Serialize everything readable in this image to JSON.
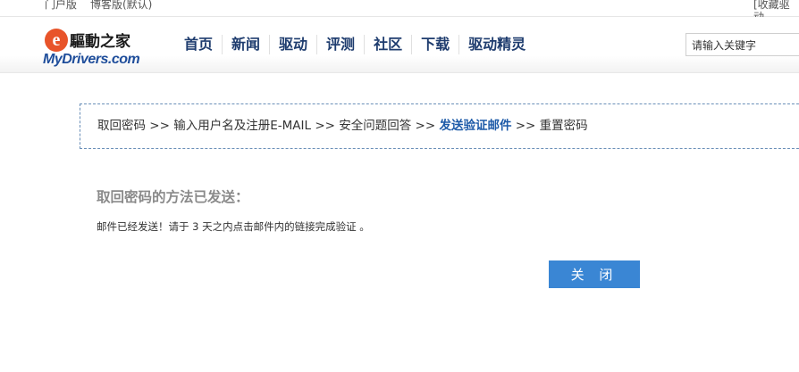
{
  "topbar": {
    "portal": "门户版",
    "blog": "博客版(默认)",
    "favorite": "[收藏驱动"
  },
  "logo": {
    "cn_text": "驅動之家",
    "brand": "MyDrivers.com"
  },
  "nav": {
    "items": [
      "首页",
      "新闻",
      "驱动",
      "评测",
      "社区",
      "下载",
      "驱动精灵"
    ]
  },
  "search": {
    "value": "请输入关键字"
  },
  "steps": {
    "s1": "取回密码",
    "sep": ">>",
    "s2": "输入用户名及注册E-MAIL",
    "s3": "安全问题回答",
    "s4": "发送验证邮件",
    "s5": "重置密码"
  },
  "result": {
    "heading": "取回密码的方法已发送：",
    "message": "邮件已经发送！请于 3 天之内点击邮件内的链接完成验证 。"
  },
  "close_button": "关 闭",
  "colors": {
    "accent": "#3a86d4",
    "nav_text": "#1e3c6e",
    "current_step": "#1d5aa8"
  }
}
